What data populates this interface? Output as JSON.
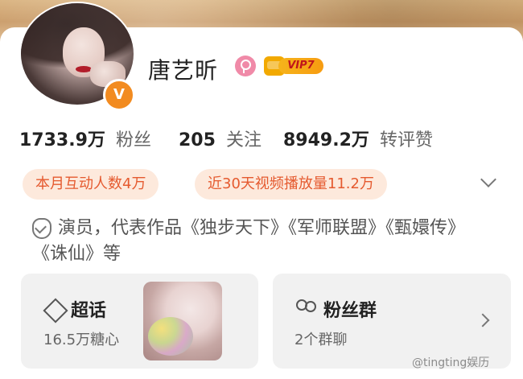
{
  "profile": {
    "name": "唐艺昕",
    "vip_label": "VIP7"
  },
  "stats": [
    {
      "value": "1733.9万",
      "label": "粉丝"
    },
    {
      "value": "205",
      "label": "关注"
    },
    {
      "value": "8949.2万",
      "label": "转评赞"
    }
  ],
  "pills": [
    {
      "label": "本月互动人数4万"
    },
    {
      "label": "近30天视频播放量11.2万"
    }
  ],
  "verification": {
    "text": "演员，代表作品《独步天下》《军师联盟》《甄嬛传》《诛仙》等"
  },
  "cards": {
    "super_topic": {
      "title": "超话",
      "subtitle": "16.5万糖心"
    },
    "fan_group": {
      "title": "粉丝群",
      "subtitle": "2个群聊"
    }
  },
  "watermark": "@tingting娱历",
  "colors": {
    "accent_orange": "#e55a2f",
    "pill_bg": "#fde9dc",
    "v_badge": "#f28b20",
    "vip_gold": "#f6b31b"
  },
  "icons": {
    "gender": "female-icon",
    "verified": "verified-v-icon",
    "shield": "shield-icon",
    "super_topic": "diamond-icon",
    "fan_group": "people-icon",
    "expand": "chevron-down-icon",
    "open": "chevron-right-icon"
  }
}
